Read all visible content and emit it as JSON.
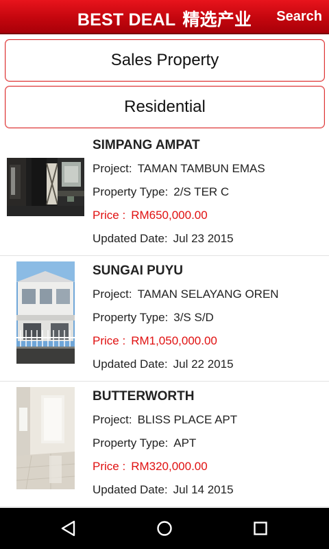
{
  "header": {
    "title_en": "BEST DEAL",
    "title_cn": "精选产业",
    "search_label": "Search"
  },
  "selectors": {
    "category": "Sales Property",
    "type": "Residential"
  },
  "labels": {
    "project": "Project:",
    "property_type": "Property Type:",
    "price": "Price :",
    "updated": "Updated Date:"
  },
  "listings": [
    {
      "location": "SIMPANG AMPAT",
      "project": "TAMAN TAMBUN EMAS",
      "property_type": "2/S TER C",
      "price": "RM650,000.00",
      "updated": "Jul 23 2015"
    },
    {
      "location": "SUNGAI PUYU",
      "project": "TAMAN SELAYANG OREN",
      "property_type": "3/S S/D",
      "price": "RM1,050,000.00",
      "updated": "Jul 22 2015"
    },
    {
      "location": "BUTTERWORTH",
      "project": "BLISS PLACE APT",
      "property_type": "APT",
      "price": "RM320,000.00",
      "updated": "Jul 14 2015"
    }
  ],
  "navbar": {
    "icons": [
      "back-icon",
      "home-icon",
      "recent-apps-icon"
    ]
  }
}
